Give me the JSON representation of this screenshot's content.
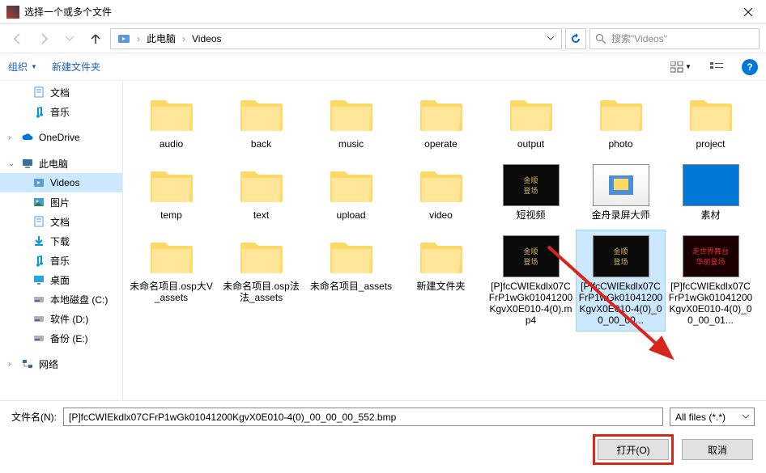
{
  "window": {
    "title": "选择一个或多个文件"
  },
  "nav": {
    "path_root": "此电脑",
    "path_item": "Videos",
    "search_placeholder": "搜索\"Videos\""
  },
  "toolbar": {
    "organize": "组织",
    "new_folder": "新建文件夹"
  },
  "sidebar": {
    "items": [
      {
        "label": "文档",
        "icon": "doc",
        "indent": true
      },
      {
        "label": "音乐",
        "icon": "music",
        "indent": true
      },
      {
        "label": "OneDrive",
        "icon": "cloud",
        "top": true,
        "spaced": true
      },
      {
        "label": "此电脑",
        "icon": "pc",
        "top": true,
        "spaced": true
      },
      {
        "label": "Videos",
        "icon": "video",
        "indent": true,
        "selected": true
      },
      {
        "label": "图片",
        "icon": "pic",
        "indent": true
      },
      {
        "label": "文档",
        "icon": "doc",
        "indent": true
      },
      {
        "label": "下载",
        "icon": "down",
        "indent": true
      },
      {
        "label": "音乐",
        "icon": "music",
        "indent": true
      },
      {
        "label": "桌面",
        "icon": "desk",
        "indent": true
      },
      {
        "label": "本地磁盘 (C:)",
        "icon": "disk",
        "indent": true
      },
      {
        "label": "软件 (D:)",
        "icon": "disk",
        "indent": true
      },
      {
        "label": "备份 (E:)",
        "icon": "disk",
        "indent": true
      },
      {
        "label": "网络",
        "icon": "net",
        "top": true,
        "spaced": true
      }
    ]
  },
  "files": {
    "row1": [
      {
        "label": "audio",
        "type": "folder"
      },
      {
        "label": "back",
        "type": "folder"
      },
      {
        "label": "music",
        "type": "folder"
      },
      {
        "label": "operate",
        "type": "folder"
      },
      {
        "label": "output",
        "type": "folder"
      },
      {
        "label": "photo",
        "type": "folder"
      },
      {
        "label": "project",
        "type": "folder"
      }
    ],
    "row2": [
      {
        "label": "temp",
        "type": "folder"
      },
      {
        "label": "text",
        "type": "folder"
      },
      {
        "label": "upload",
        "type": "folder"
      },
      {
        "label": "video",
        "type": "folder"
      },
      {
        "label": "短视频",
        "type": "thumb-dark"
      },
      {
        "label": "金舟录屏大师",
        "type": "thumb-color"
      },
      {
        "label": "素材",
        "type": "thumb-blue"
      }
    ],
    "row3": [
      {
        "label": "未命名项目.osp大V_assets",
        "type": "folder"
      },
      {
        "label": "未命名项目.osp法法_assets",
        "type": "folder"
      },
      {
        "label": "未命名项目_assets",
        "type": "folder-mp4"
      },
      {
        "label": "新建文件夹",
        "type": "folder-clip"
      },
      {
        "label": "[P]fcCWIEkdlx07CFrP1wGk01041200KgvX0E010-4(0).mp4",
        "type": "thumb-dark"
      },
      {
        "label": "[P]fcCWIEkdlx07CFrP1wGk01041200KgvX0E010-4(0)_00_00_00...",
        "type": "thumb-dark",
        "selected": true
      },
      {
        "label": "[P]fcCWIEkdlx07CFrP1wGk01041200KgvX0E010-4(0)_00_00_01...",
        "type": "thumb-red"
      }
    ]
  },
  "footer": {
    "filename_label": "文件名(N):",
    "filename_value": "[P]fcCWIEkdlx07CFrP1wGk01041200KgvX0E010-4(0)_00_00_00_552.bmp",
    "filter": "All files (*.*)",
    "open": "打开(O)",
    "cancel": "取消"
  }
}
